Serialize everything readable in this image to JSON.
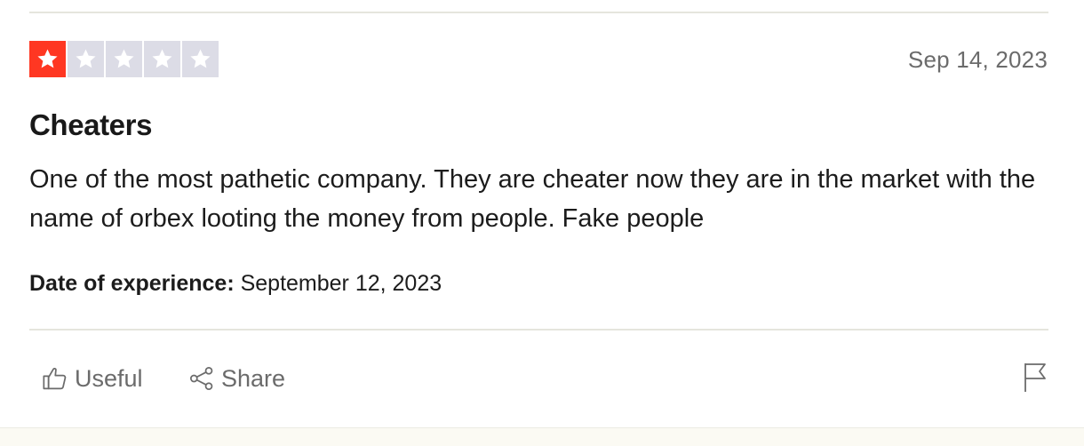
{
  "review": {
    "rating": 1,
    "rating_max": 5,
    "date": "Sep 14, 2023",
    "title": "Cheaters",
    "body": "One of the most pathetic company. They are cheater now they are in the market with the name of orbex looting the money from people. Fake people",
    "experience_label": "Date of experience:",
    "experience_date": "September 12, 2023"
  },
  "actions": {
    "useful_label": "Useful",
    "share_label": "Share"
  },
  "colors": {
    "star_filled": "#ff3722",
    "star_empty": "#dcdce6",
    "muted_text": "#6b6b6b"
  },
  "icons": [
    "star-icon",
    "thumbs-up-icon",
    "share-icon",
    "flag-icon"
  ]
}
